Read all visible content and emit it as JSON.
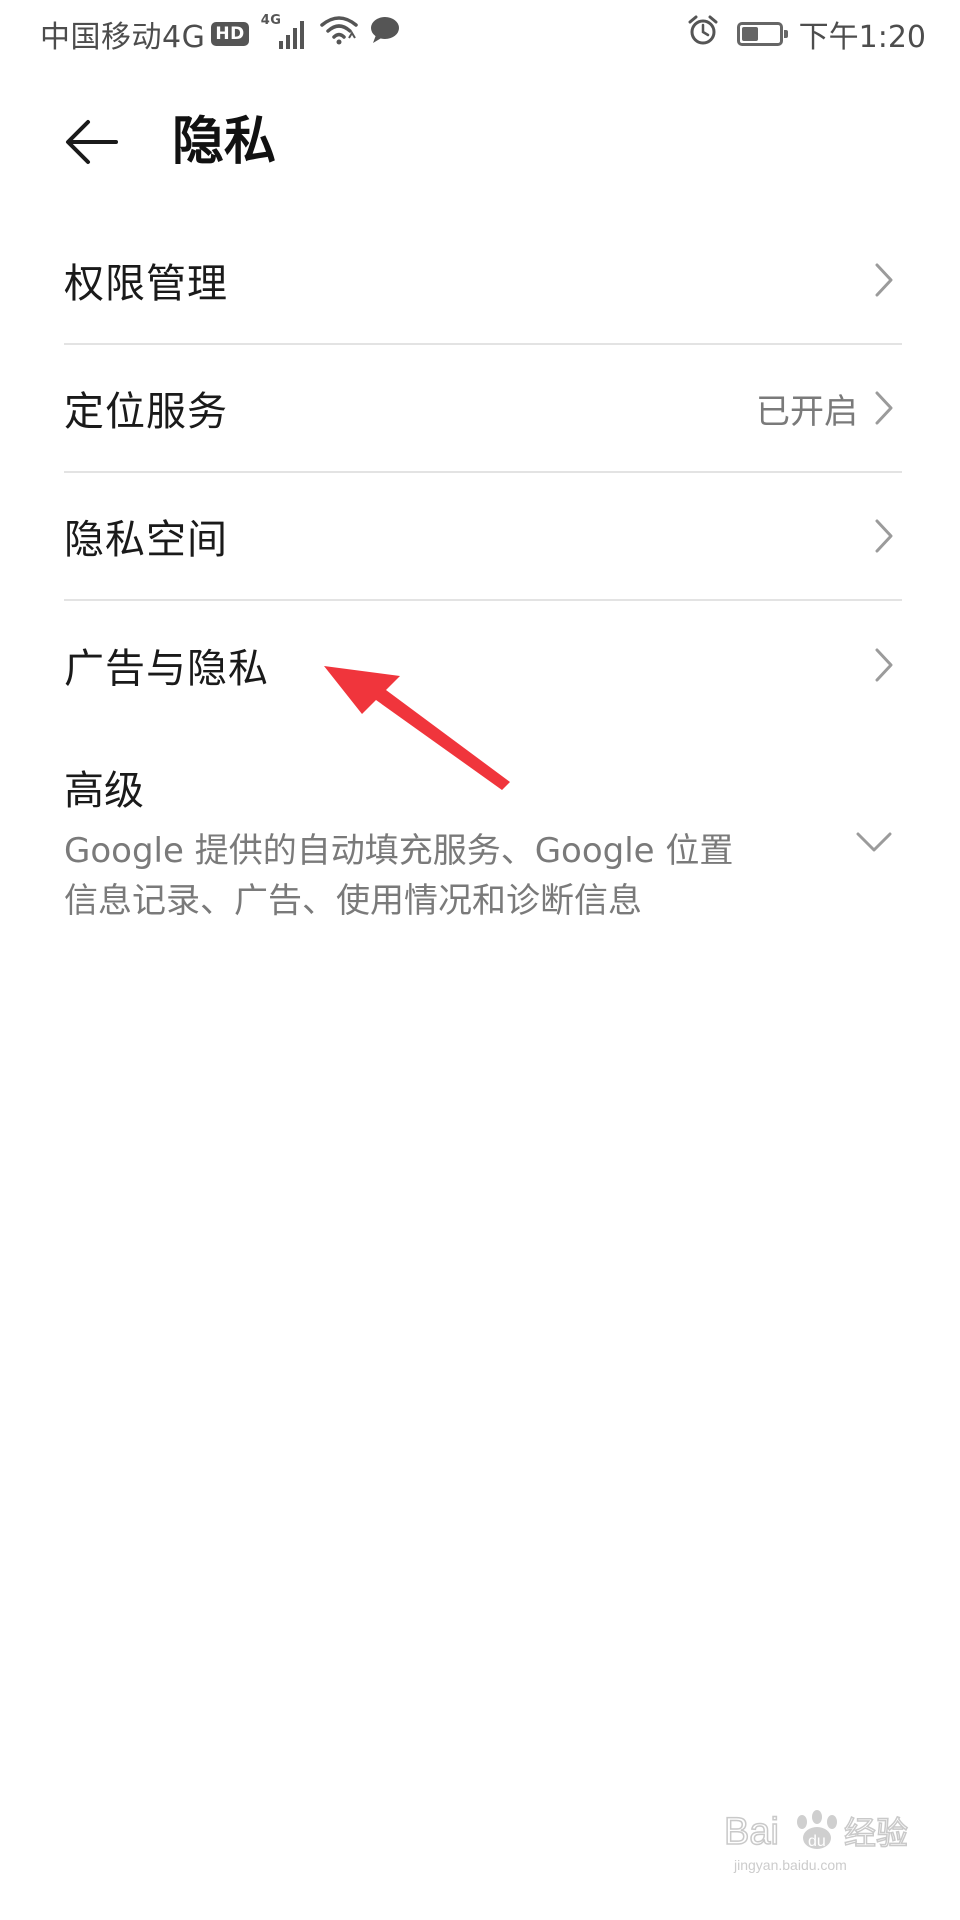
{
  "status_bar": {
    "carrier": "中国移动4G",
    "hd_badge": "HD",
    "network_label": "4G",
    "time": "下午1:20",
    "battery_fill": 0.45
  },
  "header": {
    "title": "隐私",
    "back_icon": "arrow-left-icon"
  },
  "list_items": [
    {
      "label": "权限管理",
      "value": ""
    },
    {
      "label": "定位服务",
      "value": "已开启"
    },
    {
      "label": "隐私空间",
      "value": ""
    },
    {
      "label": "广告与隐私",
      "value": ""
    }
  ],
  "advanced": {
    "title": "高级",
    "description": "Google 提供的自动填充服务、Google 位置信息记录、广告、使用情况和诊断信息"
  },
  "watermark": {
    "brand": "Bai",
    "suffix": "经验",
    "url": "jingyan.baidu.com"
  },
  "colors": {
    "annotation_arrow": "#f0353c",
    "divider": "#e3e3e3",
    "secondary_text": "#7a7a7a"
  }
}
